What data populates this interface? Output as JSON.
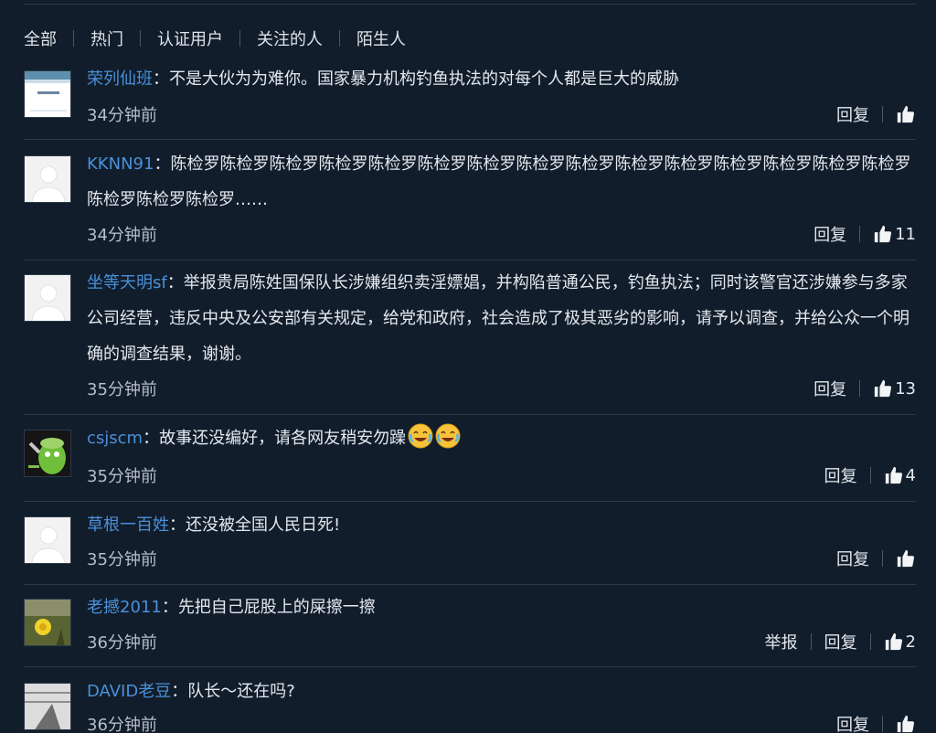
{
  "tabs": [
    {
      "label": "全部"
    },
    {
      "label": "热门"
    },
    {
      "label": "认证用户"
    },
    {
      "label": "关注的人"
    },
    {
      "label": "陌生人"
    }
  ],
  "actions": {
    "reply": "回复",
    "report": "举报",
    "colon": "："
  },
  "comments": [
    {
      "username": "荣列仙班",
      "text": "不是大伙为为难你。国家暴力机构钓鱼执法的对每个人都是巨大的威胁",
      "time": "34分钟前",
      "likes": ""
    },
    {
      "username": "KKNN91",
      "text": "陈检罗陈检罗陈检罗陈检罗陈检罗陈检罗陈检罗陈检罗陈检罗陈检罗陈检罗陈检罗陈检罗陈检罗陈检罗陈检罗陈检罗陈检罗……",
      "time": "34分钟前",
      "likes": "11"
    },
    {
      "username": "坐等天明sf",
      "text": "举报贵局陈姓国保队长涉嫌组织卖淫嫖娼，并构陷普通公民，钓鱼执法；同时该警官还涉嫌参与多家公司经营，违反中央及公安部有关规定，给党和政府，社会造成了极其恶劣的影响，请予以调查，并给公众一个明确的调查结果，谢谢。",
      "time": "35分钟前",
      "likes": "13"
    },
    {
      "username": "csjscm",
      "text": "故事还没编好，请各网友稍安勿躁",
      "time": "35分钟前",
      "likes": "4",
      "emoji": "laugh-cry"
    },
    {
      "username": "草根一百姓",
      "text": "还没被全国人民日死!",
      "time": "35分钟前",
      "likes": ""
    },
    {
      "username": "老撼2011",
      "text": "先把自己屁股上的屎擦一擦",
      "time": "36分钟前",
      "likes": "2"
    },
    {
      "username": "DAVID老豆",
      "text": "队长～还在吗?",
      "time": "36分钟前",
      "likes": ""
    }
  ],
  "colors": {
    "background": "#111d2b",
    "username": "#4a90d9",
    "divider": "#2a3a4c"
  }
}
